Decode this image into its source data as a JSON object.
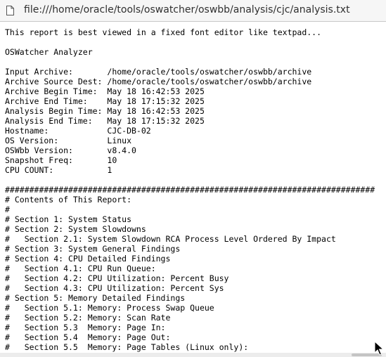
{
  "address_bar": {
    "icon": "page-icon",
    "url": "file:///home/oracle/tools/oswatcher/oswbb/analysis/cjc/analysis.txt"
  },
  "report": {
    "lines": [
      "This report is best viewed in a fixed font editor like textpad...",
      "",
      "OSWatcher Analyzer",
      "",
      "Input Archive:       /home/oracle/tools/oswatcher/oswbb/archive",
      "Archive Source Dest: /home/oracle/tools/oswatcher/oswbb/archive",
      "Archive Begin Time:  May 18 16:42:53 2025",
      "Archive End Time:    May 18 17:15:32 2025",
      "Analysis Begin Time: May 18 16:42:53 2025",
      "Analysis End Time:   May 18 17:15:32 2025",
      "Hostname:            CJC-DB-02",
      "OS Version:          Linux",
      "OSWbb Version:       v8.4.0",
      "Snapshot Freq:       10",
      "CPU COUNT:           1",
      "",
      "############################################################################",
      "# Contents of This Report:",
      "#",
      "# Section 1: System Status",
      "# Section 2: System Slowdowns",
      "#   Section 2.1: System Slowdown RCA Process Level Ordered By Impact",
      "# Section 3: System General Findings",
      "# Section 4: CPU Detailed Findings",
      "#   Section 4.1: CPU Run Queue:",
      "#   Section 4.2: CPU Utilization: Percent Busy",
      "#   Section 4.3: CPU Utilization: Percent Sys",
      "# Section 5: Memory Detailed Findings",
      "#   Section 5.1: Memory: Process Swap Queue",
      "#   Section 5.2: Memory: Scan Rate",
      "#   Section 5.3  Memory: Page In:",
      "#   Section 5.4  Memory: Page Out:",
      "#   Section 5.5  Memory: Page Tables (Linux only):"
    ]
  }
}
